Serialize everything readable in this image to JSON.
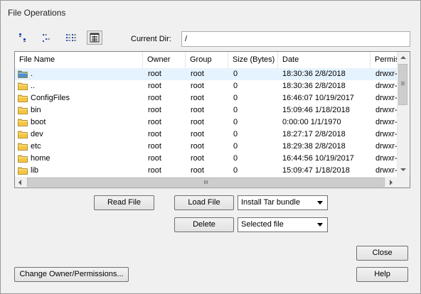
{
  "window": {
    "title": "File Operations"
  },
  "toolbar": {
    "views": [
      "large-icons-view-icon",
      "small-icons-view-icon",
      "list-view-icon",
      "details-view-icon"
    ]
  },
  "current_dir": {
    "label": "Current Dir:",
    "value": "/"
  },
  "table": {
    "columns": [
      "File Name",
      "Owner",
      "Group",
      "Size (Bytes)",
      "Date",
      "Permis"
    ],
    "rows": [
      {
        "name": ".",
        "owner": "root",
        "group": "root",
        "size": "0",
        "date": "18:30:36 2/8/2018",
        "perm": "drwxr-x"
      },
      {
        "name": "..",
        "owner": "root",
        "group": "root",
        "size": "0",
        "date": "18:30:36 2/8/2018",
        "perm": "drwxr-x"
      },
      {
        "name": "ConfigFiles",
        "owner": "root",
        "group": "root",
        "size": "0",
        "date": "16:46:07 10/19/2017",
        "perm": "drwxr-x"
      },
      {
        "name": "bin",
        "owner": "root",
        "group": "root",
        "size": "0",
        "date": "15:09:46 1/18/2018",
        "perm": "drwxr-x"
      },
      {
        "name": "boot",
        "owner": "root",
        "group": "root",
        "size": "0",
        "date": " 0:00:00 1/1/1970",
        "perm": "drwxr-x"
      },
      {
        "name": "dev",
        "owner": "root",
        "group": "root",
        "size": "0",
        "date": "18:27:17 2/8/2018",
        "perm": "drwxr-x"
      },
      {
        "name": "etc",
        "owner": "root",
        "group": "root",
        "size": "0",
        "date": "18:29:38 2/8/2018",
        "perm": "drwxr-x"
      },
      {
        "name": "home",
        "owner": "root",
        "group": "root",
        "size": "0",
        "date": "16:44:56 10/19/2017",
        "perm": "drwxr-x"
      },
      {
        "name": "lib",
        "owner": "root",
        "group": "root",
        "size": "0",
        "date": "15:09:47 1/18/2018",
        "perm": "drwxr-x"
      }
    ]
  },
  "buttons": {
    "read_file": "Read File",
    "load_file": "Load File",
    "delete": "Delete",
    "close": "Close",
    "help": "Help",
    "change_owner": "Change Owner/Permissions..."
  },
  "dropdowns": {
    "load_type": "Install Tar bundle",
    "delete_target": "Selected file"
  },
  "colors": {
    "folder": "#f5c542",
    "folder_open": "#4a8fd0",
    "selection": "#e5f3ff"
  }
}
